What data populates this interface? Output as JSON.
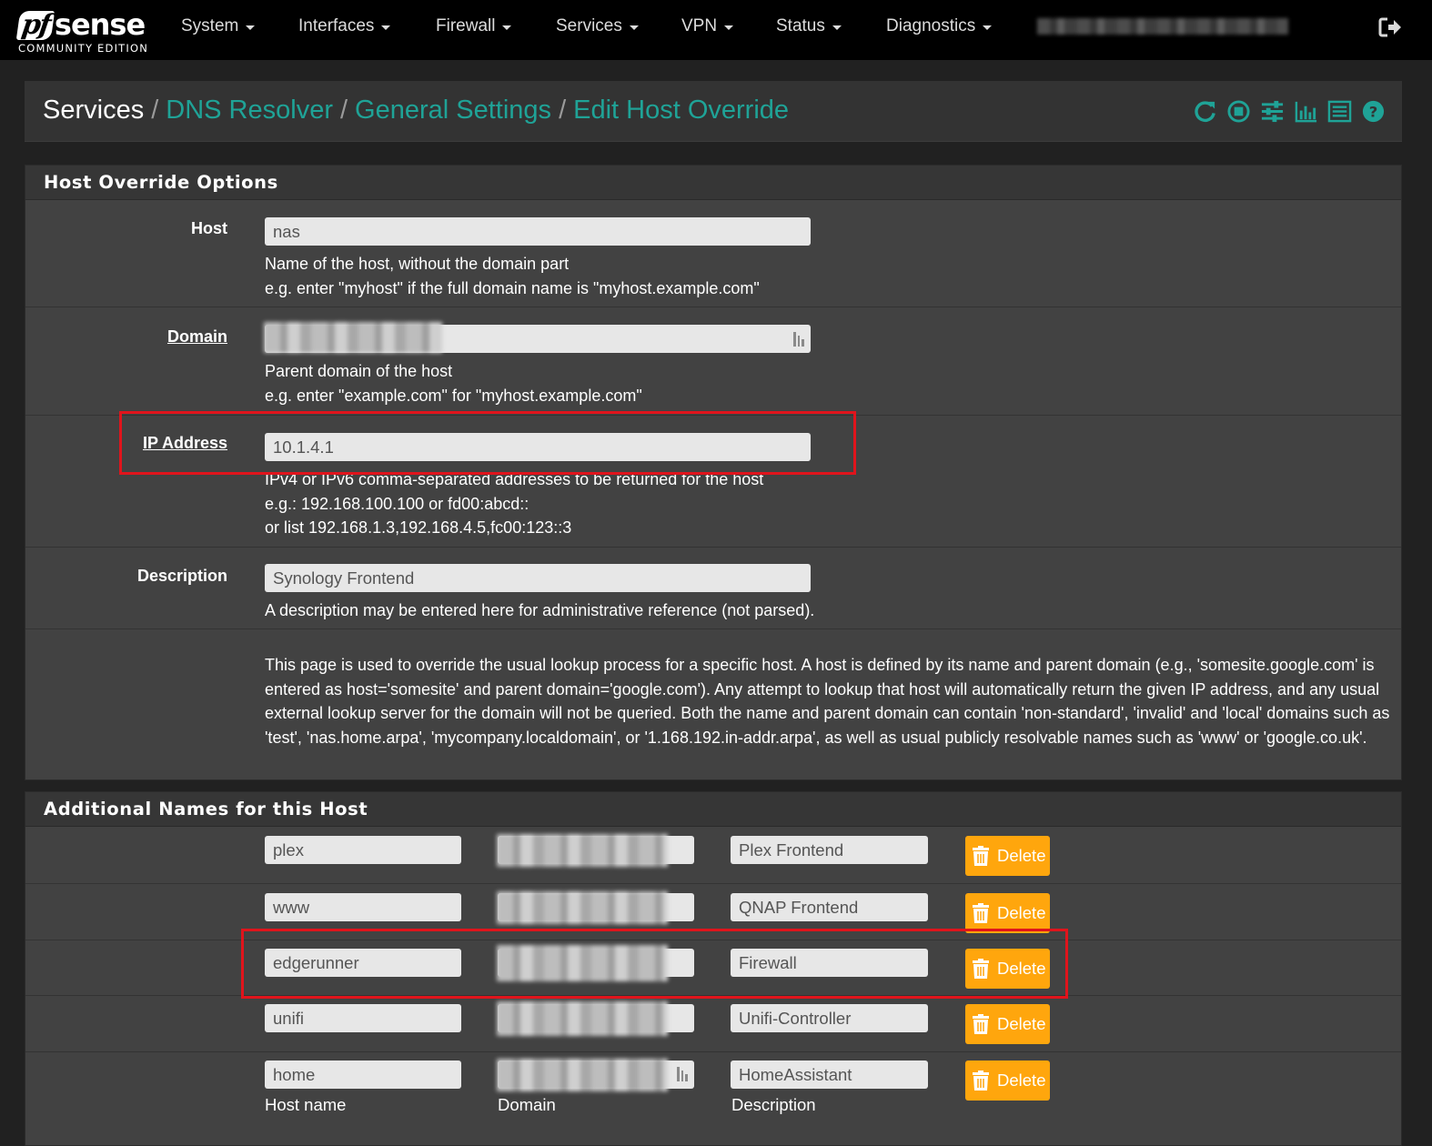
{
  "navbar": {
    "logo_text": "pfsense",
    "logo_sub": "COMMUNITY EDITION",
    "menu": [
      "System",
      "Interfaces",
      "Firewall",
      "Services",
      "VPN",
      "Status",
      "Diagnostics"
    ],
    "logout_icon": "logout-icon"
  },
  "breadcrumb": {
    "root": "Services",
    "items": [
      "DNS Resolver",
      "General Settings",
      "Edit Host Override"
    ],
    "separator": "/",
    "icons": [
      "reload-icon",
      "stop-icon",
      "settings-icon",
      "chart-icon",
      "log-icon",
      "help-icon"
    ]
  },
  "host_override": {
    "title": "Host Override Options",
    "host": {
      "label": "Host",
      "value": "nas",
      "help": [
        "Name of the host, without the domain part",
        "e.g. enter \"myhost\" if the full domain name is \"myhost.example.com\""
      ]
    },
    "domain": {
      "label": "Domain",
      "help": [
        "Parent domain of the host",
        "e.g. enter \"example.com\" for \"myhost.example.com\""
      ]
    },
    "ip": {
      "label": "IP Address",
      "value": "10.1.4.1",
      "help": [
        "IPv4 or IPv6 comma-separated addresses to be returned for the host",
        "e.g.: 192.168.100.100 or fd00:abcd::",
        "or list 192.168.1.3,192.168.4.5,fc00:123::3"
      ]
    },
    "description": {
      "label": "Description",
      "value": "Synology Frontend",
      "help": "A description may be entered here for administrative reference (not parsed)."
    },
    "info": "This page is used to override the usual lookup process for a specific host. A host is defined by its name and parent domain (e.g., 'somesite.google.com' is entered as host='somesite' and parent domain='google.com'). Any attempt to lookup that host will automatically return the given IP address, and any usual external lookup server for the domain will not be queried. Both the name and parent domain can contain 'non-standard', 'invalid' and 'local' domains such as 'test', 'nas.home.arpa', 'mycompany.localdomain', or '1.168.192.in-addr.arpa', as well as usual publicly resolvable names such as 'www' or 'google.co.uk'."
  },
  "additional_names": {
    "title": "Additional Names for this Host",
    "delete_label": "Delete",
    "rows": [
      {
        "host": "plex",
        "description": "Plex Frontend"
      },
      {
        "host": "www",
        "description": "QNAP Frontend"
      },
      {
        "host": "edgerunner",
        "description": "Firewall"
      },
      {
        "host": "unifi",
        "description": "Unifi-Controller"
      },
      {
        "host": "home",
        "description": "HomeAssistant"
      }
    ],
    "col_labels": {
      "host": "Host name",
      "domain": "Domain",
      "description": "Description"
    }
  },
  "colors": {
    "accent": "#1fa397",
    "delete": "#ffa60d",
    "highlight": "#e0141c",
    "navbar": "#000000"
  }
}
